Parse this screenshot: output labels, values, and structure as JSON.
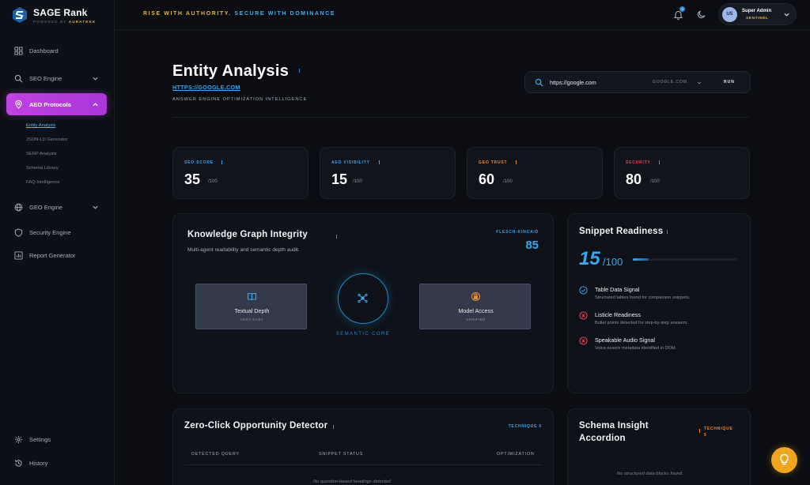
{
  "brand": {
    "name": "SAGE Rank",
    "powered_prefix": "POWERED BY",
    "powered_by": "AURATEKK"
  },
  "topbar": {
    "tagline_a": "RISE WITH AUTHORITY.",
    "tagline_b": "SECURE WITH DOMINANCE",
    "notification_count": "3",
    "user": {
      "initials": "US",
      "name": "Super Admin",
      "role": "SENTINEL"
    }
  },
  "sidebar": {
    "items": [
      {
        "label": "Dashboard",
        "icon": "grid-icon"
      },
      {
        "label": "SEO Engine",
        "icon": "search-icon"
      },
      {
        "label": "AEO Protocols",
        "icon": "location-pin-icon"
      },
      {
        "label": "GEO Engine",
        "icon": "globe-icon"
      },
      {
        "label": "Security Engine",
        "icon": "shield-icon"
      },
      {
        "label": "Report Generator",
        "icon": "chart-icon"
      }
    ],
    "aeo_subitems": [
      "Entity Analysis",
      "JSON-LD Generator",
      "SERP Analysis",
      "Schema Library",
      "FAQ Intelligence"
    ],
    "footer": [
      {
        "label": "Settings",
        "icon": "gear-icon"
      },
      {
        "label": "History",
        "icon": "history-icon"
      }
    ]
  },
  "header": {
    "title": "Entity Analysis",
    "url": "HTTPS://GOOGLE.COM",
    "subtitle": "ANSWER ENGINE OPTIMIZATION INTELLIGENCE"
  },
  "search": {
    "value": "https://google.com",
    "engine": "GOOGLE.COM",
    "run_label": "RUN"
  },
  "scores": [
    {
      "label": "SEO SCORE",
      "value": "35",
      "max": "/100",
      "color": "#39a6f0"
    },
    {
      "label": "AEO VISIBILITY",
      "value": "15",
      "max": "/100",
      "color": "#39a6f0"
    },
    {
      "label": "GEO TRUST",
      "value": "60",
      "max": "/100",
      "color": "#f08a2c"
    },
    {
      "label": "SECURITY",
      "value": "80",
      "max": "/100",
      "color": "#f0435a"
    }
  ],
  "knowledge_graph": {
    "title": "Knowledge Graph Integrity",
    "subtitle": "Multi-agent readability and semantic depth audit.",
    "metric_label": "FLESCH-KINCAID",
    "metric_value": "85",
    "textual_depth": {
      "title": "Textual Depth",
      "sub": "VERY EASY"
    },
    "model_access": {
      "title": "Model Access",
      "sub": "VERIFIED"
    },
    "core_label": "SEMANTIC CORE"
  },
  "snippet": {
    "title": "Snippet Readiness",
    "score": "15",
    "max": "/100",
    "score_fraction": 0.15,
    "signals": [
      {
        "title": "Table Data Signal",
        "desc": "Structured tables found for comparison snippets.",
        "status": "pass"
      },
      {
        "title": "Listicle Readiness",
        "desc": "Bullet points detected for step-by-step answers.",
        "status": "fail"
      },
      {
        "title": "Speakable Audio Signal",
        "desc": "Voice-search metadata identified in DOM.",
        "status": "fail"
      }
    ]
  },
  "zero_click": {
    "title": "Zero-Click Opportunity Detector",
    "technique": "TECHNIQUE 6",
    "columns": [
      "DETECTED QUERY",
      "SNIPPET STATUS",
      "OPTIMIZATION"
    ],
    "empty": "No question-based headings detected."
  },
  "schema": {
    "title_line1": "Schema Insight",
    "title_line2": "Accordion",
    "technique_line1": "TECHNIQUE",
    "technique_line2": "5",
    "empty": "No structured data blocks found."
  },
  "colors": {
    "accent": "#39a6f0",
    "active_nav": "#b93ddc",
    "gold": "#e2b545",
    "fab": "#efa51d"
  }
}
